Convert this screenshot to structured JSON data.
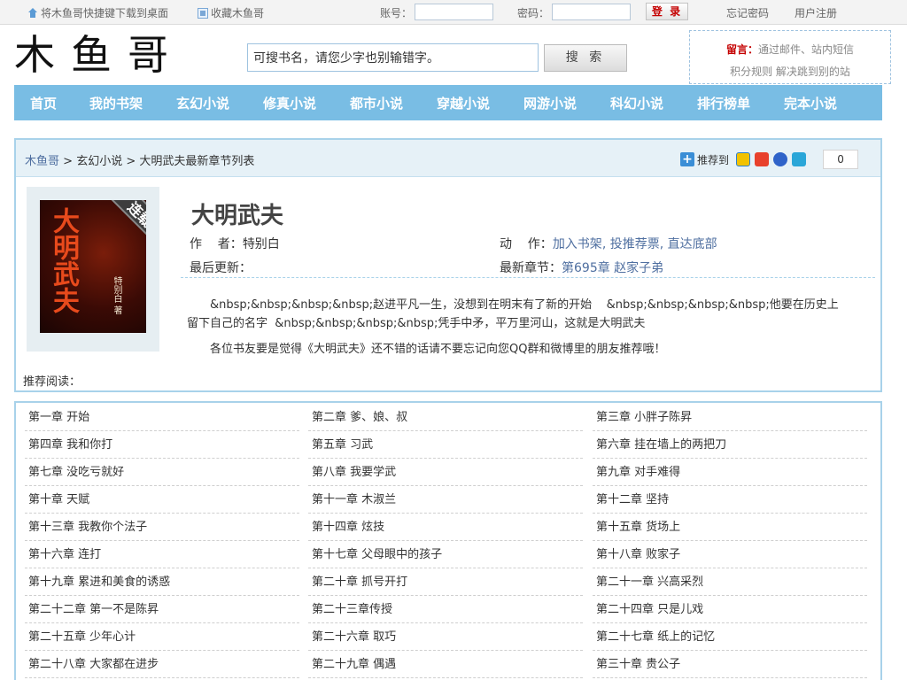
{
  "topbar": {
    "shortcut_label": "将木鱼哥快捷键下载到桌面",
    "favorite_label": "收藏木鱼哥",
    "account_label": "账号：",
    "password_label": "密码：",
    "login_label": "登 录",
    "forgot_label": "忘记密码",
    "register_label": "用户注册"
  },
  "header": {
    "logo": "木鱼哥",
    "search_placeholder": "可搜书名，请您少字也别输错字。",
    "search_button": "搜 索",
    "notice_title": "留言：",
    "notice_line1": "通过邮件、站内短信",
    "notice_line2": "积分规则  解决跳到别的站"
  },
  "nav": {
    "items": [
      "首页",
      "我的书架",
      "玄幻小说",
      "修真小说",
      "都市小说",
      "穿越小说",
      "网游小说",
      "科幻小说",
      "排行榜单",
      "完本小说"
    ]
  },
  "breadcrumb": {
    "home": "木鱼哥",
    "sep1": " > ",
    "category": "玄幻小说",
    "sep2": " > ",
    "current": "大明武夫最新章节列表"
  },
  "share": {
    "label": "推荐到",
    "count": "0"
  },
  "book": {
    "cover_title": "大明武夫",
    "cover_author": "特别白 著",
    "cover_ribbon": "连载中",
    "title": "大明武夫",
    "author_label": "作    者：",
    "author": "特别白",
    "actions_label": "动    作：",
    "action_shelf": "加入书架",
    "action_vote": "投推荐票",
    "action_bottom": "直达底部",
    "updated_label": "最后更新：",
    "updated": "",
    "latest_label": "最新章节：",
    "latest": "第695章 赵家子弟",
    "intro": "&nbsp;&nbsp;&nbsp;&nbsp;赵进平凡一生，没想到在明末有了新的开始    &nbsp;&nbsp;&nbsp;&nbsp;他要在历史上留下自己的名字  &nbsp;&nbsp;&nbsp;&nbsp;凭手中矛，平万里河山，这就是大明武夫",
    "share_tip": "各位书友要是觉得《大明武夫》还不错的话请不要忘记向您QQ群和微博里的朋友推荐哦！",
    "recommend_label": "推荐阅读："
  },
  "chapters": [
    "第一章 开始",
    "第二章 爹、娘、叔",
    "第三章 小胖子陈昇",
    "第四章 我和你打",
    "第五章 习武",
    "第六章 挂在墙上的两把刀",
    "第七章 没吃亏就好",
    "第八章 我要学武",
    "第九章 对手难得",
    "第十章 天赋",
    "第十一章 木淑兰",
    "第十二章 坚持",
    "第十三章 我教你个法子",
    "第十四章 炫技",
    "第十五章 货场上",
    "第十六章 连打",
    "第十七章 父母眼中的孩子",
    "第十八章 败家子",
    "第十九章 累进和美食的诱惑",
    "第二十章 抓号开打",
    "第二十一章 兴高采烈",
    "第二十二章 第一不是陈昇",
    "第二十三章传授",
    "第二十四章 只是儿戏",
    "第二十五章 少年心计",
    "第二十六章 取巧",
    "第二十七章 纸上的记忆",
    "第二十八章 大家都在进步",
    "第二十九章 偶遇",
    "第三十章 贵公子"
  ],
  "colors": {
    "nav_bg": "#79bde4",
    "border": "#a8d2ea",
    "link_blue": "#4f6fa0",
    "red": "#c40000"
  }
}
